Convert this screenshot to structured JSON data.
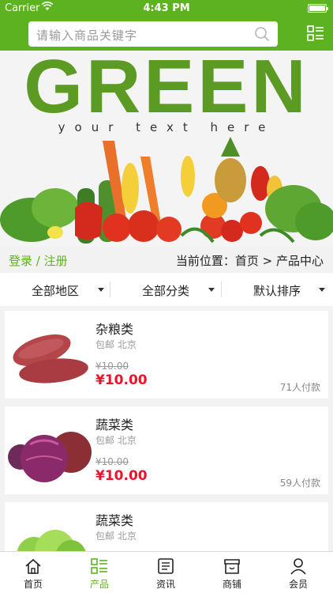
{
  "status_bar": {
    "carrier": "Carrier",
    "time": "4:43 PM"
  },
  "search": {
    "placeholder": "请输入商品关键字"
  },
  "banner": {
    "brand": "GREEN",
    "tagline": "your text here"
  },
  "breadcrumb": {
    "login_register": "登录 / 注册",
    "location": "当前位置：首页 > 产品中心"
  },
  "filters": [
    {
      "label": "全部地区"
    },
    {
      "label": "全部分类"
    },
    {
      "label": "默认排序"
    }
  ],
  "products": [
    {
      "name": "杂粮类",
      "meta": "包邮 北京",
      "old_price": "¥10.00",
      "price": "¥10.00",
      "sold": "71人付款",
      "image": "sweet-potato"
    },
    {
      "name": "蔬菜类",
      "meta": "包邮 北京",
      "old_price": "¥10.00",
      "price": "¥10.00",
      "sold": "59人付款",
      "image": "red-onion"
    },
    {
      "name": "蔬菜类",
      "meta": "包邮 北京",
      "old_price": "",
      "price": "",
      "sold": "",
      "image": "lettuce"
    }
  ],
  "tabs": [
    {
      "label": "首页",
      "icon": "home-icon",
      "active": false
    },
    {
      "label": "产品",
      "icon": "product-list-icon",
      "active": true
    },
    {
      "label": "资讯",
      "icon": "news-icon",
      "active": false
    },
    {
      "label": "商铺",
      "icon": "shop-icon",
      "active": false
    },
    {
      "label": "会员",
      "icon": "user-icon",
      "active": false
    }
  ],
  "colors": {
    "accent": "#5db31f",
    "price": "#e5172c"
  }
}
